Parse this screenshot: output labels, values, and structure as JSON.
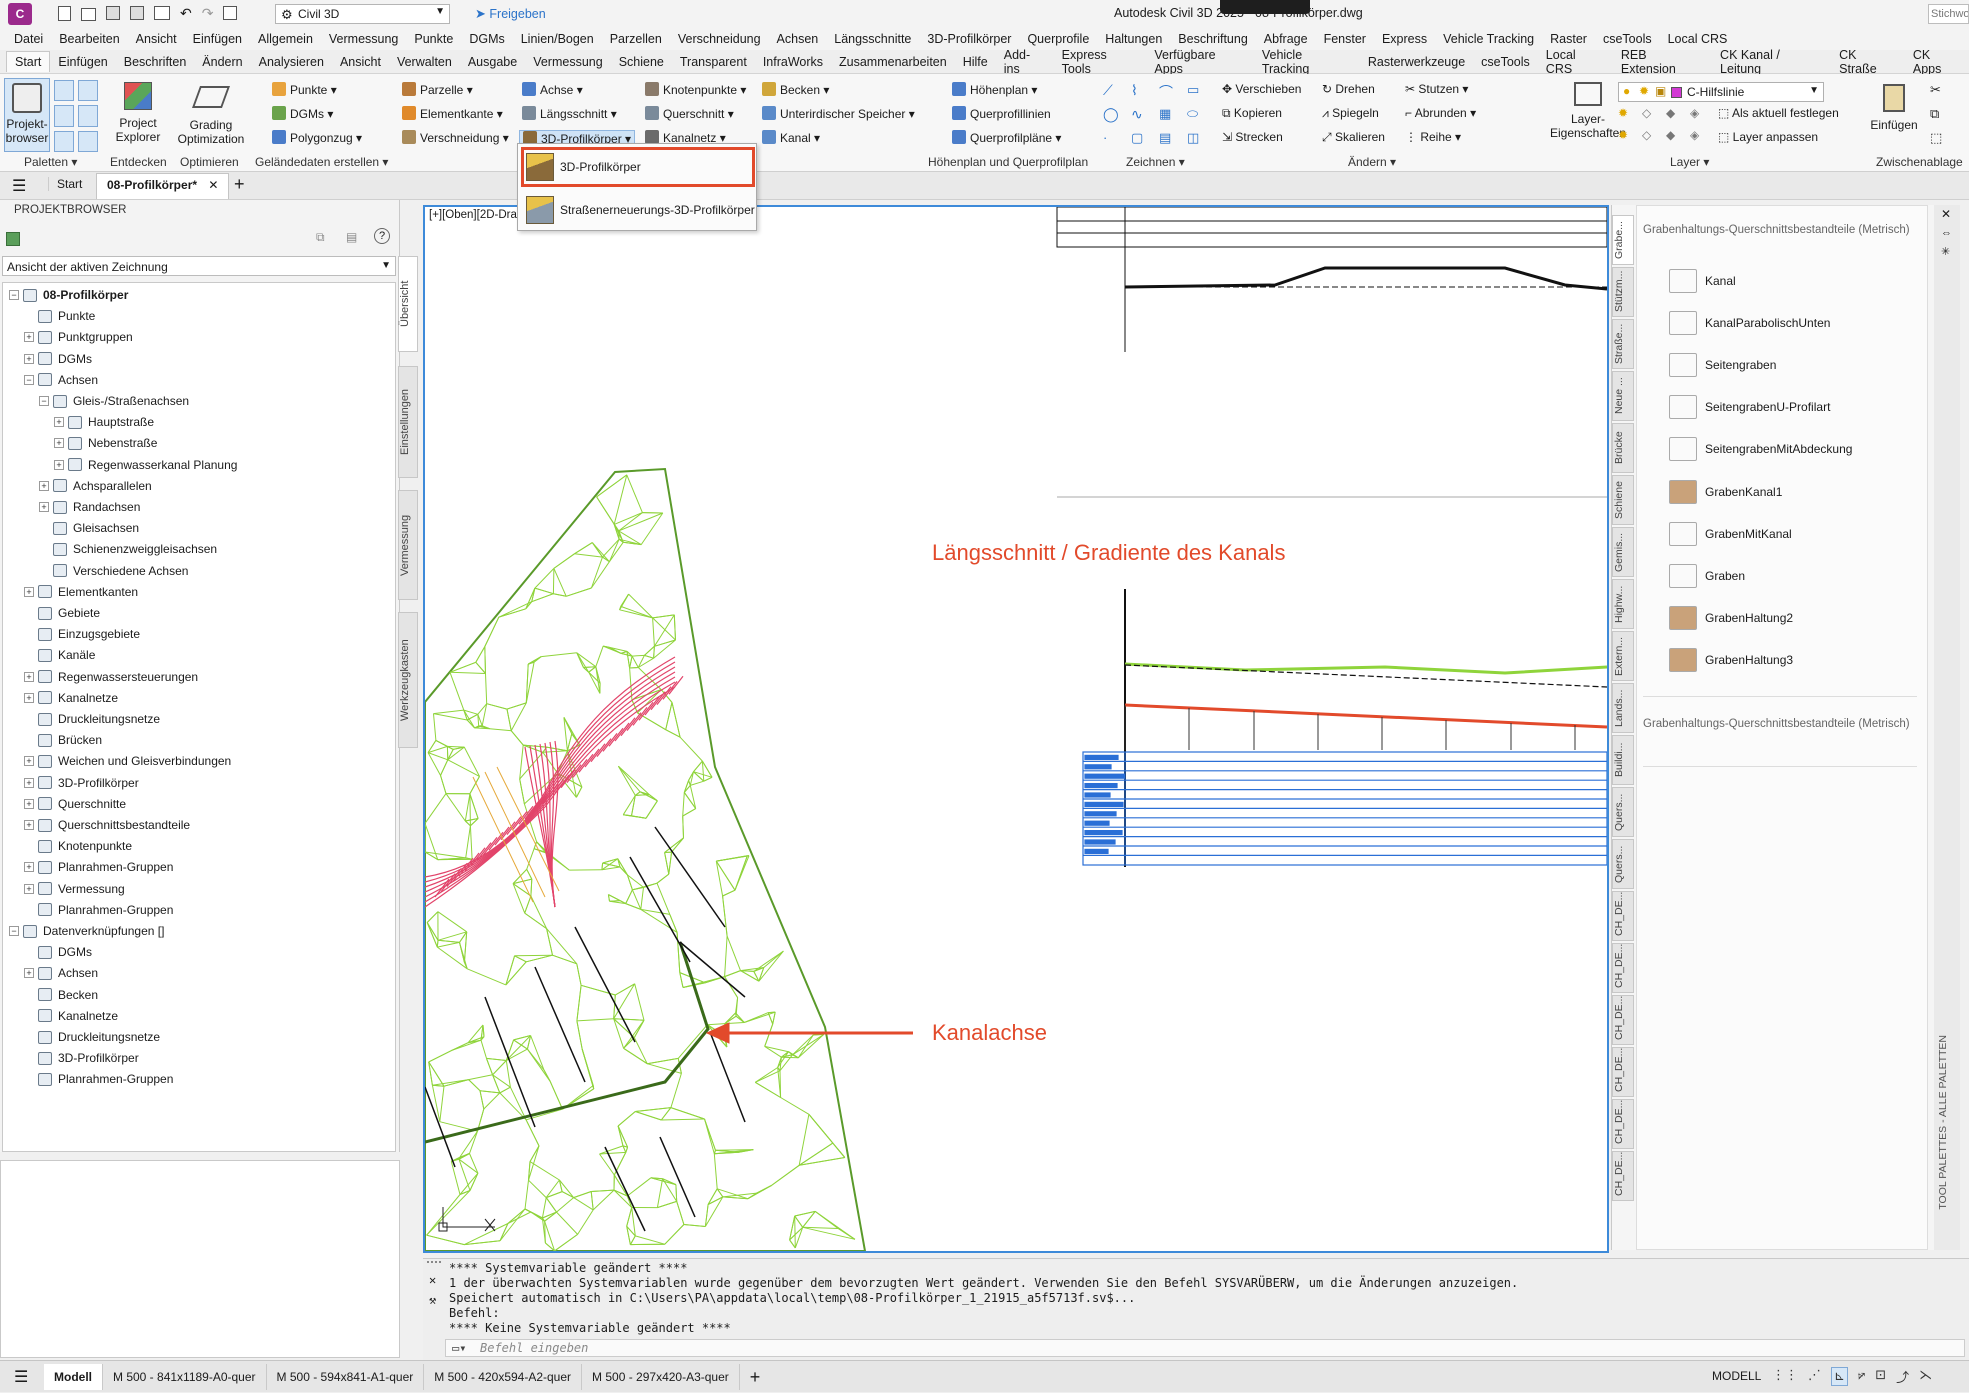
{
  "titlebar": {
    "app_badge": "C",
    "workspace": "Civil 3D",
    "share": "Freigeben",
    "title": "Autodesk Civil 3D 2025 - 08-Profilkörper.dwg",
    "search_placeholder": "Stichwo"
  },
  "menu": [
    "Datei",
    "Bearbeiten",
    "Ansicht",
    "Einfügen",
    "Allgemein",
    "Vermessung",
    "Punkte",
    "DGMs",
    "Linien/Bogen",
    "Parzellen",
    "Verschneidung",
    "Achsen",
    "Längsschnitte",
    "3D-Profilkörper",
    "Querprofile",
    "Haltungen",
    "Beschriftung",
    "Abfrage",
    "Fenster",
    "Express",
    "Vehicle Tracking",
    "Raster",
    "cseTools",
    "Local CRS"
  ],
  "ribbon_tabs": [
    "Start",
    "Einfügen",
    "Beschriften",
    "Ändern",
    "Analysieren",
    "Ansicht",
    "Verwalten",
    "Ausgabe",
    "Vermessung",
    "Schiene",
    "Transparent",
    "InfraWorks",
    "Zusammenarbeiten",
    "Hilfe",
    "Add-ins",
    "Express Tools",
    "Verfügbare Apps",
    "Vehicle Tracking",
    "Rasterwerkzeuge",
    "cseTools",
    "Local CRS",
    "REB Extension",
    "CK Kanal / Leitung",
    "CK Straße",
    "CK Apps"
  ],
  "ribbon": {
    "big_buttons": [
      {
        "label1": "Projekt-",
        "label2": "browser"
      },
      {
        "label1": "Project",
        "label2": "Explorer"
      },
      {
        "label1": "Grading",
        "label2": "Optimization"
      }
    ],
    "col1": [
      "Punkte",
      "DGMs",
      "Polygonzug"
    ],
    "col2": [
      "Parzelle",
      "Elementkante",
      "Verschneidung"
    ],
    "col3": [
      "Achse",
      "Längsschnitt",
      "3D-Profilkörper"
    ],
    "col4": [
      "Knotenpunkte",
      "Querschnitt",
      "Kanalnetz"
    ],
    "col5": [
      "Becken",
      "Unterirdischer Speicher",
      "Kanal"
    ],
    "col6": [
      "Höhenplan",
      "Querprofillinien",
      "Querprofilpläne"
    ],
    "col7": [
      "Verschieben",
      "Kopieren",
      "Strecken"
    ],
    "col8": [
      "Drehen",
      "Spiegeln",
      "Skalieren"
    ],
    "col9": [
      "Stutzen",
      "Abrunden",
      "Reihe"
    ],
    "layer_btn": {
      "label1": "Layer-",
      "label2": "Eigenschaften"
    },
    "layer_value": "C-Hilfslinie",
    "layer_actions": [
      "Als aktuell festlegen",
      "Layer anpassen"
    ],
    "paste_label": "Einfügen",
    "panels": [
      "Paletten",
      "Entdecken",
      "Optimieren",
      "Geländedaten erstellen",
      "Höhenplan und Querprofilplan",
      "Zeichnen",
      "Ändern",
      "Layer",
      "Zwischenablage"
    ]
  },
  "dropdown": {
    "items": [
      "3D-Profilkörper",
      "Straßenerneuerungs-3D-Profilkörper"
    ]
  },
  "doc_tabs": [
    "Start",
    "08-Profilkörper*"
  ],
  "browser": {
    "header": "PROJEKTBROWSER",
    "view_select": "Ansicht der aktiven Zeichnung",
    "side_tabs": [
      "Übersicht",
      "Einstellungen",
      "Vermessung",
      "Werkzeugkasten"
    ],
    "tree": [
      {
        "label": "08-Profilkörper",
        "level": 0,
        "exp": "−",
        "bold": true
      },
      {
        "label": "Punkte",
        "level": 1,
        "exp": ""
      },
      {
        "label": "Punktgruppen",
        "level": 1,
        "exp": "+"
      },
      {
        "label": "DGMs",
        "level": 1,
        "exp": "+"
      },
      {
        "label": "Achsen",
        "level": 1,
        "exp": "−"
      },
      {
        "label": "Gleis-/Straßenachsen",
        "level": 2,
        "exp": "−"
      },
      {
        "label": "Hauptstraße",
        "level": 3,
        "exp": "+"
      },
      {
        "label": "Nebenstraße",
        "level": 3,
        "exp": "+"
      },
      {
        "label": "Regenwasserkanal Planung",
        "level": 3,
        "exp": "+"
      },
      {
        "label": "Achsparallelen",
        "level": 2,
        "exp": "+"
      },
      {
        "label": "Randachsen",
        "level": 2,
        "exp": "+"
      },
      {
        "label": "Gleisachsen",
        "level": 2,
        "exp": ""
      },
      {
        "label": "Schienenzweiggleisachsen",
        "level": 2,
        "exp": ""
      },
      {
        "label": "Verschiedene Achsen",
        "level": 2,
        "exp": ""
      },
      {
        "label": "Elementkanten",
        "level": 1,
        "exp": "+"
      },
      {
        "label": "Gebiete",
        "level": 1,
        "exp": ""
      },
      {
        "label": "Einzugsgebiete",
        "level": 1,
        "exp": ""
      },
      {
        "label": "Kanäle",
        "level": 1,
        "exp": ""
      },
      {
        "label": "Regenwassersteuerungen",
        "level": 1,
        "exp": "+"
      },
      {
        "label": "Kanalnetze",
        "level": 1,
        "exp": "+"
      },
      {
        "label": "Druckleitungsnetze",
        "level": 1,
        "exp": ""
      },
      {
        "label": "Brücken",
        "level": 1,
        "exp": ""
      },
      {
        "label": "Weichen und Gleisverbindungen",
        "level": 1,
        "exp": "+"
      },
      {
        "label": "3D-Profilkörper",
        "level": 1,
        "exp": "+"
      },
      {
        "label": "Querschnitte",
        "level": 1,
        "exp": "+"
      },
      {
        "label": "Querschnittsbestandteile",
        "level": 1,
        "exp": "+"
      },
      {
        "label": "Knotenpunkte",
        "level": 1,
        "exp": ""
      },
      {
        "label": "Planrahmen-Gruppen",
        "level": 1,
        "exp": "+"
      },
      {
        "label": "Vermessung",
        "level": 1,
        "exp": "+"
      },
      {
        "label": "Planrahmen-Gruppen",
        "level": 1,
        "exp": ""
      },
      {
        "label": "Datenverknüpfungen []",
        "level": 0,
        "exp": "−"
      },
      {
        "label": "DGMs",
        "level": 1,
        "exp": ""
      },
      {
        "label": "Achsen",
        "level": 1,
        "exp": "+"
      },
      {
        "label": "Becken",
        "level": 1,
        "exp": ""
      },
      {
        "label": "Kanalnetze",
        "level": 1,
        "exp": ""
      },
      {
        "label": "Druckleitungsnetze",
        "level": 1,
        "exp": ""
      },
      {
        "label": "3D-Profilkörper",
        "level": 1,
        "exp": ""
      },
      {
        "label": "Planrahmen-Gruppen",
        "level": 1,
        "exp": ""
      }
    ]
  },
  "canvas": {
    "viewport_label": "[+][Oben][2D-Dra",
    "annotation_profile": "Längsschnitt / Gradiente des Kanals",
    "annotation_axis": "Kanalachse",
    "annotation_color": "#e24a2b"
  },
  "palette": {
    "header": "Grabenhaltungs-Querschnittsbestandteile (Metrisch)",
    "footer": "Grabenhaltungs-Querschnittsbestandteile (Metrisch)",
    "items": [
      "Kanal",
      "KanalParabolischUnten",
      "Seitengraben",
      "SeitengrabenU-Profilart",
      "SeitengrabenMitAbdeckung",
      "GrabenKanal1",
      "GrabenMitKanal",
      "Graben",
      "GrabenHaltung2",
      "GrabenHaltung3"
    ],
    "tabs": [
      "Grabe...",
      "Stützm...",
      "Straße...",
      "Neue ...",
      "Brücke",
      "Schiene",
      "Gemis...",
      "Highw...",
      "Extern...",
      "Lands...",
      "Buildi...",
      "Quers...",
      "Quers...",
      "CH_DE...",
      "CH_DE...",
      "CH_DE...",
      "CH_DE...",
      "CH_DE...",
      "CH_DE..."
    ],
    "vertical_title": "TOOL PALETTES - ALLE PALETTEN"
  },
  "cmd": {
    "lines": [
      "**** Systemvariable geändert ****",
      "1 der überwachten Systemvariablen wurde gegenüber dem bevorzugten Wert geändert. Verwenden Sie den Befehl SYSVARÜBERW, um die Änderungen anzuzeigen.",
      "Speichert automatisch in C:\\Users\\PA\\appdata\\local\\temp\\08-Profilkörper_1_21915_a5f5713f.sv$...",
      "Befehl:",
      "**** Keine Systemvariable geändert ****"
    ],
    "placeholder": "Befehl eingeben"
  },
  "status": {
    "layouts": [
      "Modell",
      "M 500 - 841x1189-A0-quer",
      "M 500 - 594x841-A1-quer",
      "M 500 - 420x594-A2-quer",
      "M 500 - 297x420-A3-quer"
    ],
    "mode": "MODELL"
  },
  "colors": {
    "accent": "#3d8ad9",
    "mesh": "#8fd43b",
    "corridor": "#e2446a",
    "profile_line": "#e24a2b",
    "band_blue": "#2a6fd6"
  }
}
